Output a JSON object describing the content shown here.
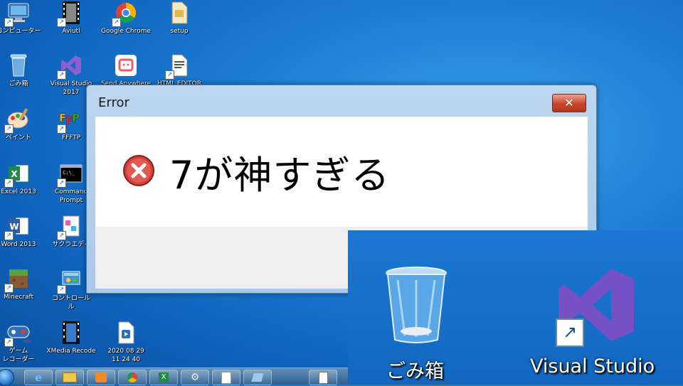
{
  "desktop": {
    "icons": [
      {
        "label": "コンピューター",
        "icon": "computer-icon"
      },
      {
        "label": "ごみ箱",
        "icon": "recycle-bin-icon"
      },
      {
        "label": "ペイント",
        "icon": "paint-icon"
      },
      {
        "label": "Excel 2013",
        "icon": "excel-icon"
      },
      {
        "label": "Word 2013",
        "icon": "word-icon"
      },
      {
        "label": "Minecraft",
        "icon": "minecraft-icon"
      },
      {
        "label": "ゲーム\nレコーダー",
        "icon": "game-recorder-icon"
      },
      {
        "label": "Aviutl",
        "icon": "film-icon"
      },
      {
        "label": "Visual Studio\n2017",
        "icon": "visual-studio-icon"
      },
      {
        "label": "FFFTP",
        "icon": "ffftp-icon"
      },
      {
        "label": "Command\nPrompt",
        "icon": "command-prompt-icon"
      },
      {
        "label": "サクラエディ",
        "icon": "sakura-editor-icon"
      },
      {
        "label": "コントロール\nル",
        "icon": "control-panel-icon"
      },
      {
        "label": "XMedia Recode",
        "icon": "xmedia-recode-icon"
      },
      {
        "label": "Google Chrome",
        "icon": "chrome-icon"
      },
      {
        "label": "Send Anywhere",
        "icon": "send-anywhere-icon"
      },
      {
        "label": "2020 08 29\n11 24 40",
        "icon": "media-file-icon"
      },
      {
        "label": "setup",
        "icon": "setup-icon"
      },
      {
        "label": "HTML EDITOR",
        "icon": "html-file-icon"
      }
    ]
  },
  "dialog": {
    "title": "Error",
    "close_label": "✕",
    "message": "7が神すぎる",
    "icon": "error-icon"
  },
  "taskbar": {
    "items": [
      "start-orb",
      "internet-explorer-icon",
      "explorer-icon",
      "media-player-icon",
      "chrome-icon",
      "excel-icon",
      "gear-icon",
      "sakura-editor-icon",
      "network-icon",
      "html-file-icon"
    ]
  },
  "zoom_overlay": {
    "items": [
      {
        "label": "ごみ箱",
        "icon": "recycle-bin-icon"
      },
      {
        "label": "Visual Studio",
        "icon": "visual-studio-icon"
      }
    ]
  },
  "colors": {
    "desktop_blue": "#1d7fd6",
    "dialog_frame": "#a9c9ea",
    "close_red": "#c7442c",
    "error_red": "#d0413a",
    "vs_purple": "#7a4fc4"
  }
}
